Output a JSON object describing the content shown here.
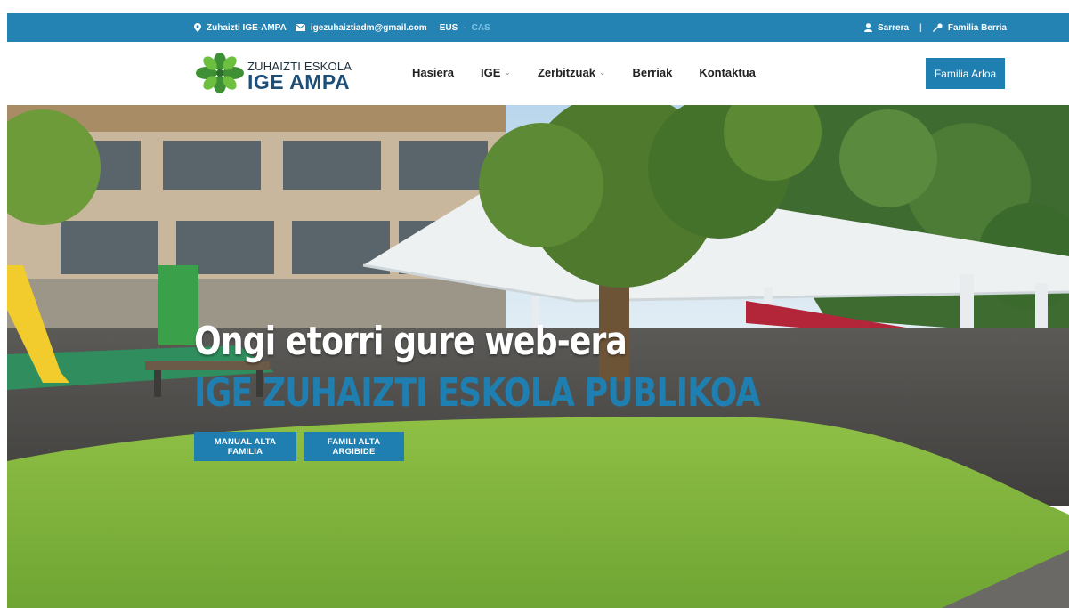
{
  "topbar": {
    "location": "Zuhaizti IGE-AMPA",
    "email": "igezuhaiztiadm@gmail.com",
    "lang_active": "EUS",
    "lang_separator": "-",
    "lang_inactive": "CAS",
    "login": "Sarrera",
    "divider": "|",
    "register": "Familia Berria",
    "icons": [
      "map-marker-icon",
      "envelope-icon",
      "user-icon",
      "key-icon"
    ]
  },
  "logo": {
    "line1": "ZUHAIZTI ESKOLA",
    "line2": "IGE AMPA"
  },
  "nav": {
    "items": [
      {
        "label": "Hasiera",
        "has_dropdown": false
      },
      {
        "label": "IGE",
        "has_dropdown": true
      },
      {
        "label": "Zerbitzuak",
        "has_dropdown": true
      },
      {
        "label": "Berriak",
        "has_dropdown": false
      },
      {
        "label": "Kontaktua",
        "has_dropdown": false
      }
    ],
    "cta": "Familia Arloa"
  },
  "hero": {
    "title": "Ongi etorri gure web-era",
    "subtitle": "IGE ZUHAIZTI ESKOLA PUBLIKOA",
    "buttons": [
      "MANUAL ALTA FAMILIA",
      "FAMILI ALTA ARGIBIDE"
    ]
  },
  "colors": {
    "brand_blue": "#2483b3",
    "button_blue": "#1f7fb1",
    "logo_green": "#4c9a3c"
  }
}
